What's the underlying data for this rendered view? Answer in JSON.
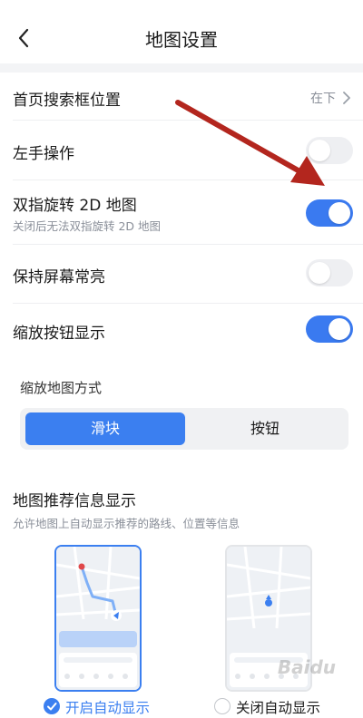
{
  "header": {
    "title": "地图设置",
    "back_icon": "chevron-left-icon"
  },
  "settings": {
    "search_box": {
      "label": "首页搜索框位置",
      "value": "在下"
    },
    "left_hand": {
      "label": "左手操作",
      "enabled": false
    },
    "rotate_2d": {
      "label": "双指旋转 2D 地图",
      "desc": "关闭后无法双指旋转 2D 地图",
      "enabled": true
    },
    "screen_on": {
      "label": "保持屏幕常亮",
      "enabled": false
    },
    "zoom_buttons": {
      "label": "缩放按钮显示",
      "enabled": true
    }
  },
  "zoom_mode": {
    "label": "缩放地图方式",
    "options": [
      "滑块",
      "按钮"
    ],
    "selected": "滑块"
  },
  "recommend": {
    "title": "地图推荐信息显示",
    "desc": "允许地图上自动显示推荐的路线、位置等信息",
    "options": [
      "开启自动显示",
      "关闭自动显示"
    ],
    "selected": "开启自动显示"
  },
  "colors": {
    "accent": "#3b7ff0",
    "annotation_arrow": "#b3261e"
  },
  "watermark": "Baidu"
}
